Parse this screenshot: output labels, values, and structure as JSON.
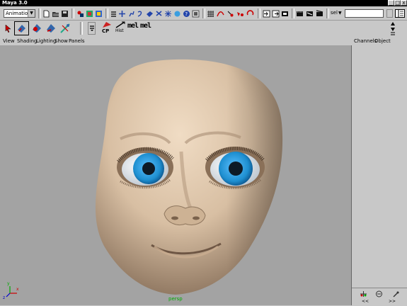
{
  "app": {
    "title": "Maya 3.0"
  },
  "window_controls": {
    "minimize": "_",
    "maximize": "□",
    "close": "x"
  },
  "status_line": {
    "menu_set": "Animation",
    "quick_select_label": "sel",
    "quick_select_value": ""
  },
  "shelf": {
    "tool_labels": {
      "cp": "CP",
      "hist": "Hist",
      "mel1": "mel",
      "mel2": "mel"
    }
  },
  "panel_menu": [
    "View",
    "Shading",
    "Lighting",
    "Show",
    "Panels"
  ],
  "channel_box": {
    "menu": [
      "Channels",
      "Object"
    ],
    "nav_prev": "<<",
    "nav_next": ">>"
  },
  "viewport": {
    "camera_label": "persp",
    "axis_labels": {
      "x": "x",
      "y": "y",
      "z": "z"
    }
  },
  "colors": {
    "viewport_bg": "#a3a3a3",
    "ui_gray": "#c8c8c8",
    "iris": "#1e8fd0",
    "skin": "#d9c1a6"
  }
}
